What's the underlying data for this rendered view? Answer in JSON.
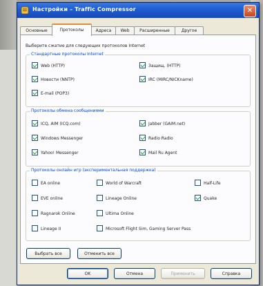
{
  "window": {
    "title": "Настройки – Traffic Compressor"
  },
  "tabs": [
    {
      "label": "Основные",
      "active": false
    },
    {
      "label": "Протоколы",
      "active": true
    },
    {
      "label": "Адреса",
      "active": false
    },
    {
      "label": "Web",
      "active": false
    },
    {
      "label": "Расширенные",
      "active": false
    },
    {
      "label": "Другое",
      "active": false
    }
  ],
  "intro_text": "Выберите сжатие для следующих протоколов Internet",
  "groups": {
    "standard": {
      "title": "Стандартные протоколы Internet",
      "items": [
        {
          "label": "Web (HTTP)",
          "checked": true
        },
        {
          "label": "Защищ. (HTTP)",
          "checked": true
        },
        {
          "label": "Новости (NNTP)",
          "checked": true
        },
        {
          "label": "IRC (MIRC/NICKname)",
          "checked": true
        },
        {
          "label": "E-mail (POP3)",
          "checked": true
        }
      ]
    },
    "messengers": {
      "title": "Протоколы обмена сообщениями",
      "items": [
        {
          "label": "ICQ, AIM (ICQ.com)",
          "checked": true
        },
        {
          "label": "Jabber (GAIM.net)",
          "checked": true
        },
        {
          "label": "Windows Messenger",
          "checked": true
        },
        {
          "label": "Radio Radio",
          "checked": true
        },
        {
          "label": "Yahoo! Messenger",
          "checked": true
        },
        {
          "label": "Mail Ru Agent",
          "checked": true
        }
      ]
    },
    "games": {
      "title": "Протоколы онлайн игр (экспериментальная поддержка)",
      "items": [
        {
          "label": "EA online",
          "checked": false
        },
        {
          "label": "World of Warcraft",
          "checked": false
        },
        {
          "label": "Half-Life",
          "checked": false
        },
        {
          "label": "EVE online",
          "checked": false
        },
        {
          "label": "Lineage Online",
          "checked": false
        },
        {
          "label": "Quake",
          "checked": true
        },
        {
          "label": "Ragnarok Online",
          "checked": false
        },
        {
          "label": "Ultima Online",
          "checked": false
        },
        {
          "label": "Lineage II",
          "checked": false
        },
        {
          "label": "Microsoft Flight Sim, Gaming Server Pass",
          "checked": false
        }
      ]
    }
  },
  "actions": {
    "select_all": "Выбрать все",
    "clear_all": "Отменить все"
  },
  "dialog_buttons": {
    "ok": "OK",
    "cancel": "Отмена",
    "apply": "Применить",
    "help": "Справка"
  },
  "colors": {
    "title_bar": "#1f5ed3",
    "group_title": "#0046d5",
    "active_tab_accent": "#e68b2c",
    "check": "#21a121"
  },
  "icons": {
    "app": "app-icon",
    "close": "close-icon"
  }
}
